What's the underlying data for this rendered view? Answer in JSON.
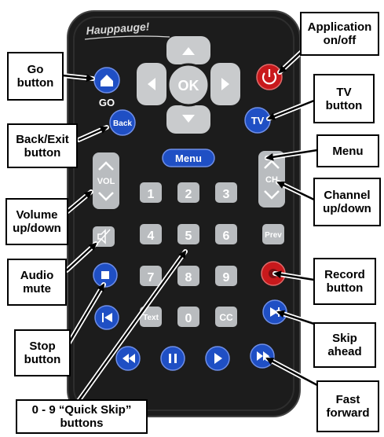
{
  "remote": {
    "brand": "Hauppauge!",
    "keys": {
      "ok": "OK",
      "go": "GO",
      "back": "Back",
      "tv": "TV",
      "menu": "Menu",
      "vol": "VOL",
      "ch": "CH",
      "prev": "Prev",
      "text": "Text",
      "cc": "CC",
      "digits": [
        "1",
        "2",
        "3",
        "4",
        "5",
        "6",
        "7",
        "8",
        "9",
        "0"
      ]
    }
  },
  "callouts": {
    "go": "Go\nbutton",
    "back": "Back/Exit\nbutton",
    "volume": "Volume\nup/down",
    "mute": "Audio\nmute",
    "stop": "Stop\nbutton",
    "quickskip": "0 - 9 “Quick Skip”\nbuttons",
    "power": "Application\non/off",
    "tv": "TV\nbutton",
    "menu": "Menu",
    "channel": "Channel\nup/down",
    "record": "Record\nbutton",
    "skip": "Skip\nahead",
    "ff": "Fast\nforward"
  },
  "colors": {
    "body": "#1c1c1c",
    "blue_key": "#1f4fc4",
    "grey_key": "#b9bcbf",
    "red_key": "#c8191c",
    "dpad": "#c9cbcd"
  }
}
